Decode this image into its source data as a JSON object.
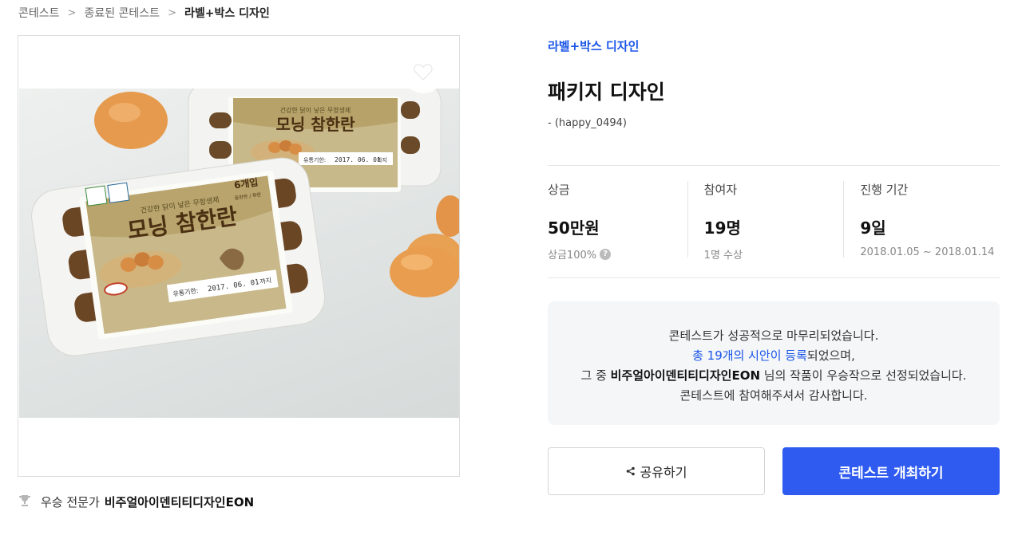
{
  "breadcrumb": {
    "items": [
      "콘테스트",
      "종료된 콘테스트",
      "라벨+박스 디자인"
    ]
  },
  "product_image": {
    "label_top_text": "건강한 닭이 낳은 무항생제",
    "label_brand": "모닝 참한란",
    "label_date_caption": "유통기한:",
    "label_date": "2017. 06. 01",
    "label_suffix": "까지",
    "label_count": "6개입",
    "label_count_sub": "동판란 / 특란"
  },
  "winner": {
    "prefix": "우승 전문가",
    "name": "비주얼아이덴티티디자인EON"
  },
  "contest": {
    "category": "라벨+박스 디자인",
    "title": "패키지 디자인",
    "author": "- (happy_0494)"
  },
  "stats": [
    {
      "label": "상금",
      "value": "50만원",
      "sub": "상금100%"
    },
    {
      "label": "참여자",
      "value": "19명",
      "sub": "1명 수상"
    },
    {
      "label": "진행 기간",
      "value": "9일",
      "sub": "2018.01.05 ~ 2018.01.14"
    }
  ],
  "notice": {
    "line1": "콘테스트가 성공적으로 마무리되었습니다.",
    "line2_link": "총 19개의 시안이 등록",
    "line2_rest": "되었으며,",
    "line3_pre": "그 중 ",
    "line3_name": "비주얼아이덴티티디자인EON",
    "line3_post": " 님의 작품이 우승작으로 선정되었습니다.",
    "line4": "콘테스트에 참여해주셔서 감사합니다."
  },
  "buttons": {
    "share": "공유하기",
    "host": "콘테스트 개최하기"
  },
  "icons": {
    "heart": "heart-icon",
    "trophy": "trophy-icon",
    "share": "share-icon",
    "help": "question-icon"
  },
  "colors": {
    "accent": "#2f5bf0",
    "link": "#1a55e8"
  }
}
